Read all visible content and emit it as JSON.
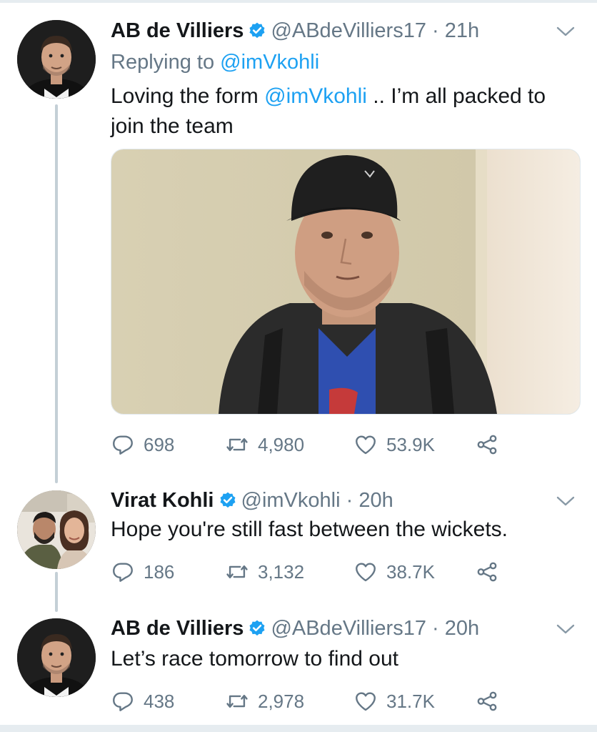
{
  "tweets": [
    {
      "name": "AB de Villiers",
      "handle": "@ABdeVilliers17",
      "dot": "·",
      "time": "21h",
      "reply_prefix": "Replying to ",
      "reply_handle": "@imVkohli",
      "text_1": "Loving the form ",
      "text_mention": "@imVkohli",
      "text_2": " .. I’m all packed to join the team",
      "replies": "698",
      "retweets": "4,980",
      "likes": "53.9K"
    },
    {
      "name": "Virat Kohli",
      "handle": "@imVkohli",
      "dot": "·",
      "time": "20h",
      "text": "Hope you're still fast between the wickets.",
      "replies": "186",
      "retweets": "3,132",
      "likes": "38.7K"
    },
    {
      "name": "AB de Villiers",
      "handle": "@ABdeVilliers17",
      "dot": "·",
      "time": "20h",
      "text": "Let’s race tomorrow to find out",
      "replies": "438",
      "retweets": "2,978",
      "likes": "31.7K"
    }
  ],
  "colors": {
    "accent": "#1da1f2",
    "muted": "#657786",
    "text": "#14171a",
    "thread": "#c4cfd6"
  },
  "icons": [
    "verified-icon",
    "chevron-down-icon",
    "reply-icon",
    "retweet-icon",
    "like-icon",
    "share-icon"
  ]
}
